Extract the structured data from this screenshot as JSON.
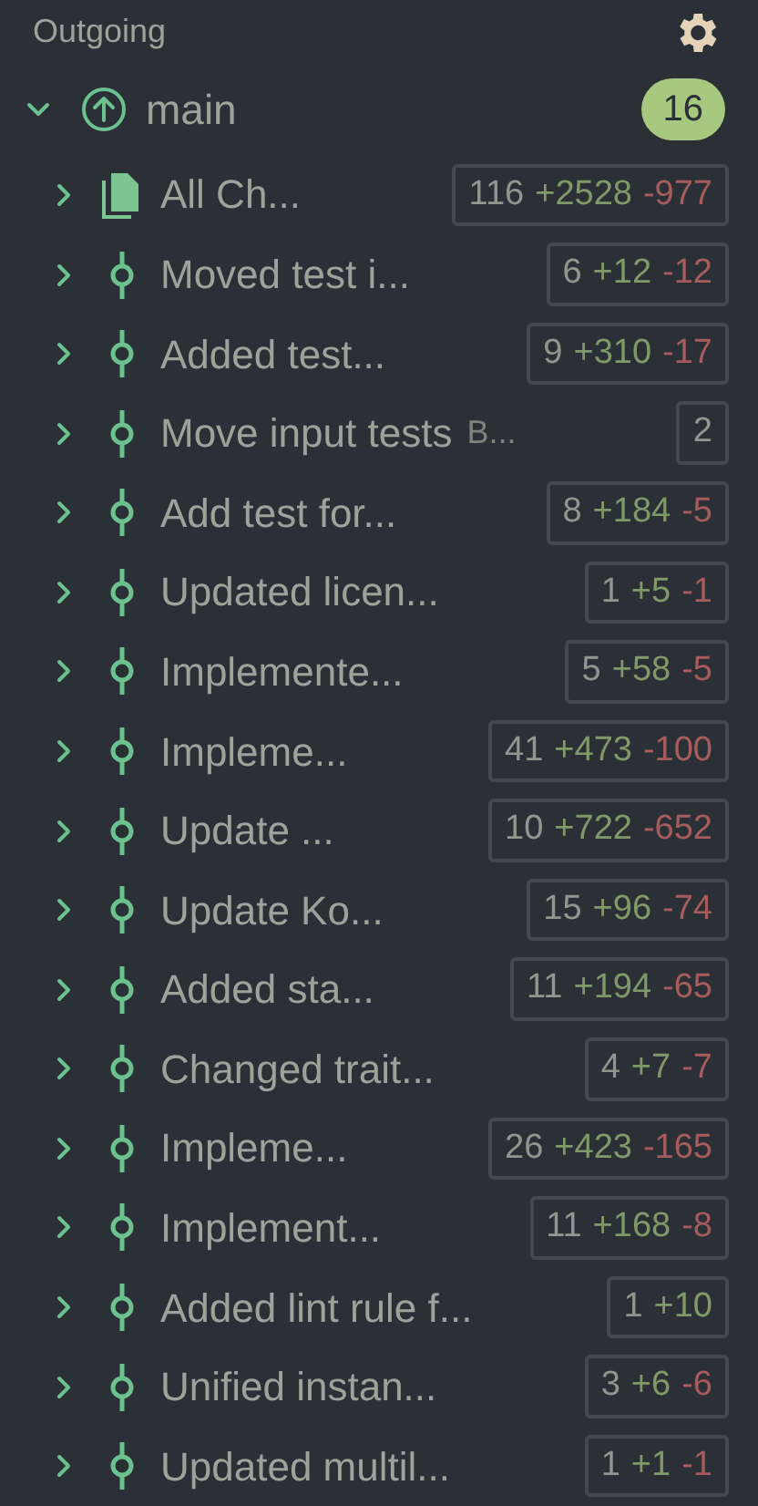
{
  "header": {
    "title": "Outgoing"
  },
  "branch": {
    "name": "main",
    "count": "16",
    "expanded": true
  },
  "rows": [
    {
      "kind": "file",
      "title": "All Ch...",
      "badge": [
        {
          "kind": "count",
          "text": "116"
        },
        {
          "kind": "added",
          "text": "+2528"
        },
        {
          "kind": "removed",
          "text": "-977"
        }
      ]
    },
    {
      "kind": "commit",
      "title": "Moved test i...",
      "badge": [
        {
          "kind": "count",
          "text": "6"
        },
        {
          "kind": "added",
          "text": "+12"
        },
        {
          "kind": "removed",
          "text": "-12"
        }
      ]
    },
    {
      "kind": "commit",
      "title": "Added test...",
      "badge": [
        {
          "kind": "count",
          "text": "9"
        },
        {
          "kind": "added",
          "text": "+310"
        },
        {
          "kind": "removed",
          "text": "-17"
        }
      ]
    },
    {
      "kind": "commit",
      "title": "Move input tests",
      "note": "B...",
      "badge": [
        {
          "kind": "count",
          "text": "2"
        }
      ]
    },
    {
      "kind": "commit",
      "title": "Add test for...",
      "badge": [
        {
          "kind": "count",
          "text": "8"
        },
        {
          "kind": "added",
          "text": "+184"
        },
        {
          "kind": "removed",
          "text": "-5"
        }
      ]
    },
    {
      "kind": "commit",
      "title": "Updated licen...",
      "badge": [
        {
          "kind": "count",
          "text": "1"
        },
        {
          "kind": "added",
          "text": "+5"
        },
        {
          "kind": "removed",
          "text": "-1"
        }
      ]
    },
    {
      "kind": "commit",
      "title": "Implemente...",
      "badge": [
        {
          "kind": "count",
          "text": "5"
        },
        {
          "kind": "added",
          "text": "+58"
        },
        {
          "kind": "removed",
          "text": "-5"
        }
      ]
    },
    {
      "kind": "commit",
      "title": "Impleme...",
      "badge": [
        {
          "kind": "count",
          "text": "41"
        },
        {
          "kind": "added",
          "text": "+473"
        },
        {
          "kind": "removed",
          "text": "-100"
        }
      ]
    },
    {
      "kind": "commit",
      "title": "Update ...",
      "badge": [
        {
          "kind": "count",
          "text": "10"
        },
        {
          "kind": "added",
          "text": "+722"
        },
        {
          "kind": "removed",
          "text": "-652"
        }
      ]
    },
    {
      "kind": "commit",
      "title": "Update Ko...",
      "badge": [
        {
          "kind": "count",
          "text": "15"
        },
        {
          "kind": "added",
          "text": "+96"
        },
        {
          "kind": "removed",
          "text": "-74"
        }
      ]
    },
    {
      "kind": "commit",
      "title": "Added sta...",
      "badge": [
        {
          "kind": "count",
          "text": "11"
        },
        {
          "kind": "added",
          "text": "+194"
        },
        {
          "kind": "removed",
          "text": "-65"
        }
      ]
    },
    {
      "kind": "commit",
      "title": "Changed trait...",
      "badge": [
        {
          "kind": "count",
          "text": "4"
        },
        {
          "kind": "added",
          "text": "+7"
        },
        {
          "kind": "removed",
          "text": "-7"
        }
      ]
    },
    {
      "kind": "commit",
      "title": "Impleme...",
      "badge": [
        {
          "kind": "count",
          "text": "26"
        },
        {
          "kind": "added",
          "text": "+423"
        },
        {
          "kind": "removed",
          "text": "-165"
        }
      ]
    },
    {
      "kind": "commit",
      "title": "Implement...",
      "badge": [
        {
          "kind": "count",
          "text": "11"
        },
        {
          "kind": "added",
          "text": "+168"
        },
        {
          "kind": "removed",
          "text": "-8"
        }
      ]
    },
    {
      "kind": "commit",
      "title": "Added lint rule f...",
      "badge": [
        {
          "kind": "count",
          "text": "1"
        },
        {
          "kind": "added",
          "text": "+10"
        }
      ]
    },
    {
      "kind": "commit",
      "title": "Unified instan...",
      "badge": [
        {
          "kind": "count",
          "text": "3"
        },
        {
          "kind": "added",
          "text": "+6"
        },
        {
          "kind": "removed",
          "text": "-6"
        }
      ]
    },
    {
      "kind": "commit",
      "title": "Updated multil...",
      "badge": [
        {
          "kind": "count",
          "text": "1"
        },
        {
          "kind": "added",
          "text": "+1"
        },
        {
          "kind": "removed",
          "text": "-1"
        }
      ]
    }
  ]
}
